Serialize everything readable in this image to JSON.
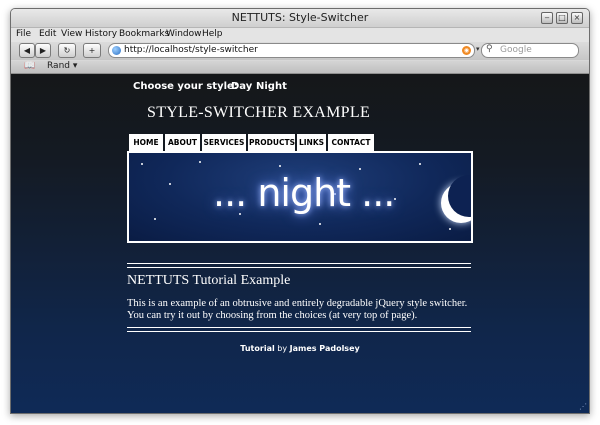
{
  "window": {
    "title": "NETTUTS: Style-Switcher",
    "buttons": [
      "‒",
      "□",
      "×"
    ]
  },
  "menubar": {
    "items": [
      "File",
      "Edit",
      "View",
      "History",
      "Bookmarks",
      "Window",
      "Help"
    ]
  },
  "toolbar": {
    "back_icon": "◀",
    "forward_icon": "▶",
    "reload_icon": "↻",
    "add_icon": "+",
    "url": "http://localhost/style-switcher",
    "rss_icon": "◉",
    "search_placeholder": "Google",
    "search_icon": "⚲"
  },
  "bookmarks": {
    "book_icon": "📖",
    "items": [
      "Rand ▾"
    ]
  },
  "page": {
    "chooser_label": "Choose your style:",
    "styles": [
      "Day",
      "Night"
    ],
    "site_title": "STYLE-SWITCHER EXAMPLE",
    "nav": [
      "HOME",
      "ABOUT",
      "SERVICES",
      "PRODUCTS",
      "LINKS",
      "CONTACT"
    ],
    "banner_text": "... night ...",
    "heading": "NETTUTS Tutorial Example",
    "paragraph": "This is an example of an obtrusive and entirely degradable jQuery style switcher. You can try it out by choosing from the choices (at very top of page).",
    "footer_strong": "Tutorial",
    "footer_by": "by",
    "footer_author": "James Padolsey"
  },
  "colors": {
    "page_top": "#151719",
    "page_bottom": "#0f2a57",
    "banner_bg": "#10285a"
  }
}
